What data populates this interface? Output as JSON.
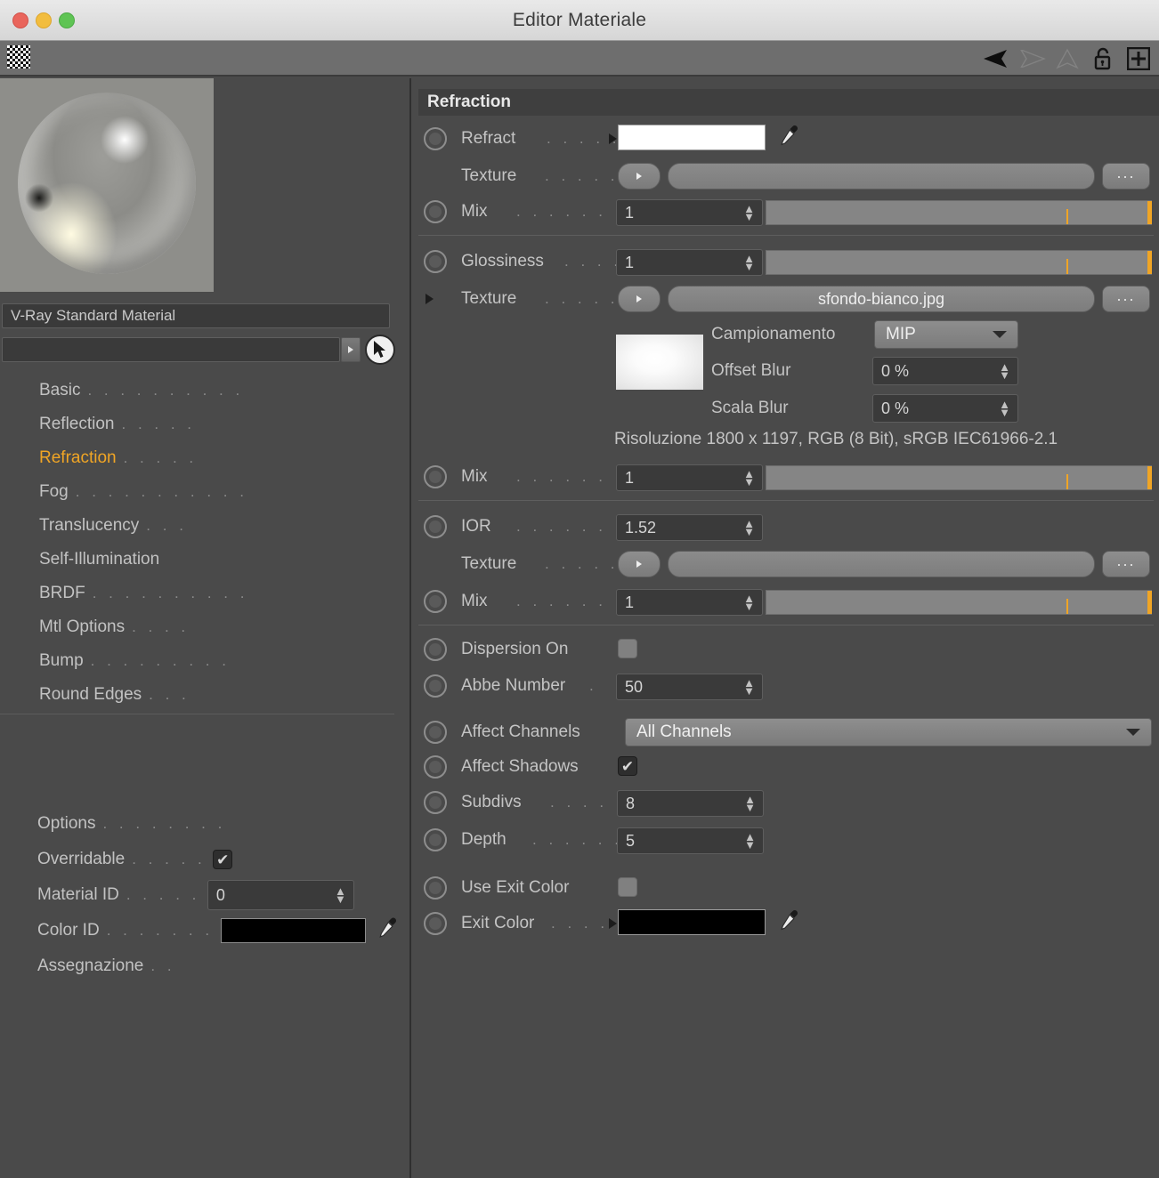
{
  "window": {
    "title": "Editor Materiale",
    "traffic": [
      "close-button",
      "minimize-button",
      "zoom-button"
    ]
  },
  "toolbar": {
    "icons": [
      "checker-swatch-icon",
      "back-triangle-icon",
      "forward-triangle-icon",
      "up-triangle-icon",
      "lock-icon",
      "plus-icon"
    ]
  },
  "left_panel": {
    "preview_label": "material-preview-sphere",
    "material_name": "V-Ray Standard Material",
    "search_value": "",
    "search_placeholder": "",
    "nav_items": [
      {
        "label": "Basic",
        "dots": ". . . . . . . . . .",
        "active": false
      },
      {
        "label": "Reflection",
        "dots": ". . . . .",
        "active": false
      },
      {
        "label": "Refraction",
        "dots": ". . . . .",
        "active": true
      },
      {
        "label": "Fog",
        "dots": ". . . . . . . . . . .",
        "active": false
      },
      {
        "label": "Translucency",
        "dots": ". . .",
        "active": false
      },
      {
        "label": "Self-Illumination",
        "dots": "",
        "active": false
      },
      {
        "label": "BRDF",
        "dots": ". . . . . . . . . .",
        "active": false
      },
      {
        "label": "Mtl Options",
        "dots": ". . . .",
        "active": false
      },
      {
        "label": "Bump",
        "dots": ". . . . . . . . .",
        "active": false
      },
      {
        "label": "Round Edges",
        "dots": ". . .",
        "active": false
      }
    ],
    "options": [
      {
        "label": "Options",
        "dots": ". . . . . . . ."
      },
      {
        "label": "Overridable",
        "dots": ". . . . ."
      },
      {
        "label": "Material ID",
        "dots": ". . . . ."
      },
      {
        "label": "Color ID",
        "dots": ". . . . . . ."
      },
      {
        "label": "Assegnazione",
        "dots": ". ."
      }
    ],
    "overridable_checked": true,
    "material_id_value": "0",
    "color_id_value": "#000000"
  },
  "right_panel": {
    "section_title": "Refraction",
    "refract": {
      "label": "Refract",
      "dots": ". . . . . .",
      "color": "#ffffff",
      "texture_label": "Texture",
      "texture_dots": ". . . . . . .",
      "texture_value": "",
      "browse_label": "...",
      "mix_label": "Mix",
      "mix_dots": ". . . . . . . . .",
      "mix_value": "1"
    },
    "glossiness": {
      "label": "Glossiness",
      "dots": ". . . .",
      "value": "1",
      "texture_label": "Texture",
      "texture_dots": ". . . . . . .",
      "texture_value": "sfondo-bianco.jpg",
      "browse_label": "...",
      "sampling_label": "Campionamento",
      "sampling_value": "MIP",
      "offset_blur_label": "Offset Blur",
      "offset_blur_value": "0 %",
      "scale_blur_label": "Scala Blur",
      "scale_blur_value": "0 %",
      "resolution_text": "Risoluzione 1800 x 1197, RGB (8 Bit), sRGB IEC61966-2.1",
      "mix_label": "Mix",
      "mix_dots": ". . . . . . . . .",
      "mix_value": "1"
    },
    "ior": {
      "label": "IOR",
      "dots": ". . . . . . . . .",
      "value": "1.52",
      "texture_label": "Texture",
      "texture_dots": ". . . . . . .",
      "texture_value": "",
      "browse_label": "...",
      "mix_label": "Mix",
      "mix_dots": ". . . . . . . . .",
      "mix_value": "1"
    },
    "dispersion": {
      "label": "Dispersion On",
      "checked": false,
      "abbe_label": "Abbe Number",
      "abbe_dots": ".",
      "abbe_value": "50"
    },
    "channels": {
      "affect_channels_label": "Affect Channels",
      "affect_channels_value": "All Channels",
      "affect_shadows_label": "Affect Shadows",
      "affect_shadows_checked": true
    },
    "quality": {
      "subdivs_label": "Subdivs",
      "subdivs_dots": ". . . . . .",
      "subdivs_value": "8",
      "depth_label": "Depth",
      "depth_dots": ". . . . . . . .",
      "depth_value": "5"
    },
    "exit": {
      "use_exit_label": "Use Exit Color",
      "use_exit_checked": false,
      "exit_color_label": "Exit Color",
      "exit_color_dots": ". . . .",
      "exit_color_value": "#000000"
    }
  },
  "colors": {
    "accent": "#f0a525",
    "panel_bg": "#4a4a4a",
    "text": "#c4c4c4"
  }
}
